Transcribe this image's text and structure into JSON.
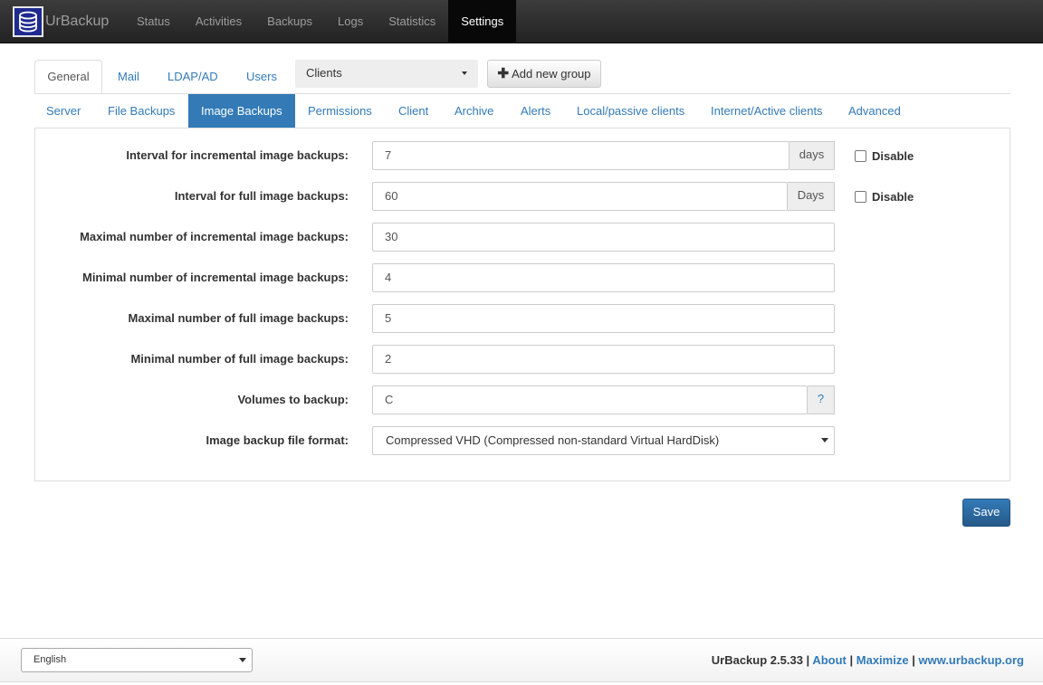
{
  "navbar": {
    "brand": "UrBackup",
    "items": [
      "Status",
      "Activities",
      "Backups",
      "Logs",
      "Statistics",
      "Settings"
    ],
    "active": "Settings"
  },
  "settings_tabs": {
    "primary": [
      "General",
      "Mail",
      "LDAP/AD",
      "Users"
    ],
    "primary_active": "General",
    "group_select": "Clients",
    "add_group_label": "Add new group",
    "secondary": [
      "Server",
      "File Backups",
      "Image Backups",
      "Permissions",
      "Client",
      "Archive",
      "Alerts",
      "Local/passive clients",
      "Internet/Active clients",
      "Advanced"
    ],
    "secondary_active": "Image Backups"
  },
  "form": {
    "incr_interval": {
      "label": "Interval for incremental image backups:",
      "value": "7",
      "unit": "days",
      "disable_label": "Disable",
      "disabled": false
    },
    "full_interval": {
      "label": "Interval for full image backups:",
      "value": "60",
      "unit": "Days",
      "disable_label": "Disable",
      "disabled": false
    },
    "max_incr": {
      "label": "Maximal number of incremental image backups:",
      "value": "30"
    },
    "min_incr": {
      "label": "Minimal number of incremental image backups:",
      "value": "4"
    },
    "max_full": {
      "label": "Maximal number of full image backups:",
      "value": "5"
    },
    "min_full": {
      "label": "Minimal number of full image backups:",
      "value": "2"
    },
    "volumes": {
      "label": "Volumes to backup:",
      "value": "C",
      "help": "?"
    },
    "file_format": {
      "label": "Image backup file format:",
      "value": "Compressed VHD (Compressed non-standard Virtual HardDisk)"
    }
  },
  "save_label": "Save",
  "footer": {
    "language": "English",
    "version": "UrBackup 2.5.33 |",
    "about": "About",
    "sep1": "|",
    "maximize": "Maximize",
    "sep2": "|",
    "website": "www.urbackup.org"
  },
  "colors": {
    "link": "#337ab7",
    "primary": "#337ab7",
    "navbar": "#222222"
  }
}
